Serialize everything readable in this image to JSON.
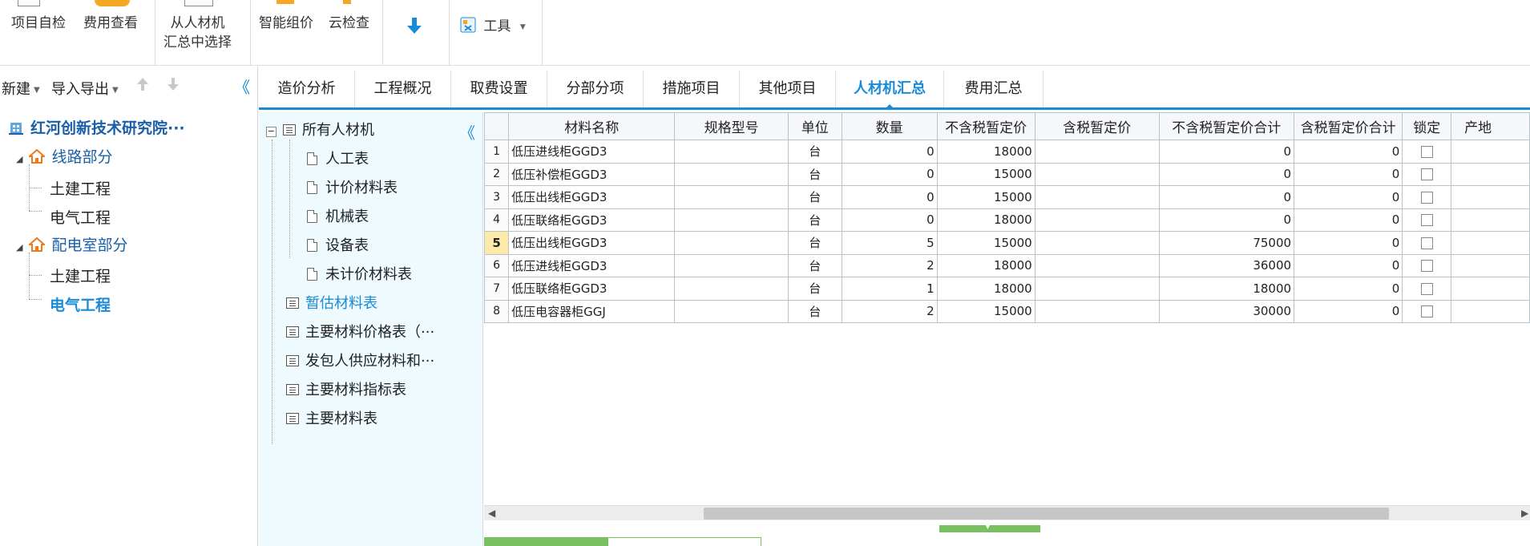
{
  "toolbar": {
    "project_check": "项目自检",
    "cost_view": "费用查看",
    "select_line1": "从人材机",
    "select_line2": "汇总中选择",
    "smart_price": "智能组价",
    "cloud_check": "云检查",
    "tools": "工具"
  },
  "left_panel": {
    "new": "新建",
    "import_export": "导入导出",
    "collapse_glyph": "《",
    "tree": {
      "root": "红河创新技术研究院···",
      "section1": "线路部分",
      "s1_civil": "土建工程",
      "s1_elec": "电气工程",
      "section2": "配电室部分",
      "s2_civil": "土建工程",
      "s2_elec": "电气工程"
    }
  },
  "tabs": [
    "造价分析",
    "工程概况",
    "取费设置",
    "分部分项",
    "措施项目",
    "其他项目",
    "人材机汇总",
    "费用汇总"
  ],
  "category_panel": {
    "collapse_glyph": "《",
    "root": "所有人材机",
    "children": [
      "人工表",
      "计价材料表",
      "机械表",
      "设备表",
      "未计价材料表"
    ],
    "reports": [
      "暂估材料表",
      "主要材料价格表（···",
      "发包人供应材料和···",
      "主要材料指标表",
      "主要材料表"
    ]
  },
  "grid": {
    "columns": [
      "材料名称",
      "规格型号",
      "单位",
      "数量",
      "不含税暂定价",
      "含税暂定价",
      "不含税暂定价合计",
      "含税暂定价合计",
      "锁定",
      "产地"
    ],
    "rows": [
      {
        "no": "1",
        "name": "低压进线柜GGD3",
        "spec": "",
        "unit": "台",
        "qty": "0",
        "price": "18000",
        "tax_price": "",
        "total": "0",
        "tax_total": "0"
      },
      {
        "no": "2",
        "name": "低压补偿柜GGD3",
        "spec": "",
        "unit": "台",
        "qty": "0",
        "price": "15000",
        "tax_price": "",
        "total": "0",
        "tax_total": "0"
      },
      {
        "no": "3",
        "name": "低压出线柜GGD3",
        "spec": "",
        "unit": "台",
        "qty": "0",
        "price": "15000",
        "tax_price": "",
        "total": "0",
        "tax_total": "0"
      },
      {
        "no": "4",
        "name": "低压联络柜GGD3",
        "spec": "",
        "unit": "台",
        "qty": "0",
        "price": "18000",
        "tax_price": "",
        "total": "0",
        "tax_total": "0"
      },
      {
        "no": "5",
        "name": "低压出线柜GGD3",
        "spec": "",
        "unit": "台",
        "qty": "5",
        "price": "15000",
        "tax_price": "",
        "total": "75000",
        "tax_total": "0"
      },
      {
        "no": "6",
        "name": "低压进线柜GGD3",
        "spec": "",
        "unit": "台",
        "qty": "2",
        "price": "18000",
        "tax_price": "",
        "total": "36000",
        "tax_total": "0"
      },
      {
        "no": "7",
        "name": "低压联络柜GGD3",
        "spec": "",
        "unit": "台",
        "qty": "1",
        "price": "18000",
        "tax_price": "",
        "total": "18000",
        "tax_total": "0"
      },
      {
        "no": "8",
        "name": "低压电容器柜GGJ",
        "spec": "",
        "unit": "台",
        "qty": "2",
        "price": "15000",
        "tax_price": "",
        "total": "30000",
        "tax_total": "0"
      }
    ]
  },
  "colors": {
    "accent": "#1a8bd6",
    "selected_row_number": "#fde9a8",
    "panel_bg": "#eefafe",
    "green_handle": "#79c060"
  }
}
